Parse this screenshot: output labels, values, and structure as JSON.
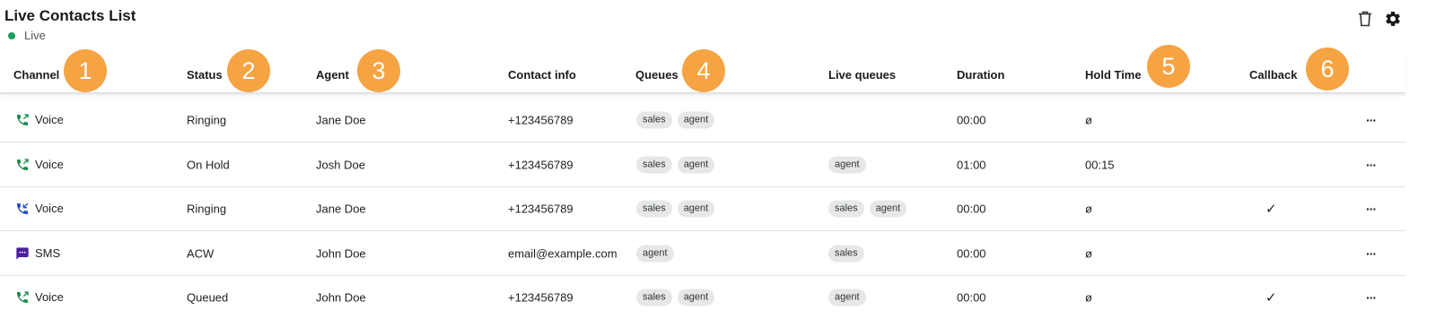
{
  "header": {
    "title": "Live Contacts List",
    "status": "Live"
  },
  "toolbar": {
    "delete_icon": "trash-icon",
    "settings_icon": "gear-icon"
  },
  "columns": [
    {
      "key": "channel",
      "label": "Channel",
      "badge": "1"
    },
    {
      "key": "status",
      "label": "Status",
      "badge": "2"
    },
    {
      "key": "agent",
      "label": "Agent",
      "badge": "3"
    },
    {
      "key": "contact",
      "label": "Contact info",
      "badge": ""
    },
    {
      "key": "queues",
      "label": "Queues",
      "badge": "4"
    },
    {
      "key": "live_queues",
      "label": "Live queues",
      "badge": ""
    },
    {
      "key": "duration",
      "label": "Duration",
      "badge": ""
    },
    {
      "key": "hold",
      "label": "Hold Time",
      "badge": "5"
    },
    {
      "key": "callback",
      "label": "Callback",
      "badge": "6"
    }
  ],
  "rows": [
    {
      "channel": "Voice",
      "channel_icon": "voice-outbound-icon",
      "status": "Ringing",
      "agent": "Jane Doe",
      "contact": "+123456789",
      "queues": [
        "sales",
        "agent"
      ],
      "live_queues": [],
      "duration": "00:00",
      "hold": "ø",
      "callback": ""
    },
    {
      "channel": "Voice",
      "channel_icon": "voice-outbound-icon",
      "status": "On Hold",
      "agent": "Josh Doe",
      "contact": "+123456789",
      "queues": [
        "sales",
        "agent"
      ],
      "live_queues": [
        "agent"
      ],
      "duration": "01:00",
      "hold": "00:15",
      "callback": ""
    },
    {
      "channel": "Voice",
      "channel_icon": "voice-inbound-icon",
      "status": "Ringing",
      "agent": "Jane Doe",
      "contact": "+123456789",
      "queues": [
        "sales",
        "agent"
      ],
      "live_queues": [
        "sales",
        "agent"
      ],
      "duration": "00:00",
      "hold": "ø",
      "callback": "✓"
    },
    {
      "channel": "SMS",
      "channel_icon": "sms-icon",
      "status": "ACW",
      "agent": "John Doe",
      "contact": "email@example.com",
      "queues": [
        "agent"
      ],
      "live_queues": [
        "sales"
      ],
      "duration": "00:00",
      "hold": "ø",
      "callback": ""
    },
    {
      "channel": "Voice",
      "channel_icon": "voice-outbound-icon",
      "status": "Queued",
      "agent": "John Doe",
      "contact": "+123456789",
      "queues": [
        "sales",
        "agent"
      ],
      "live_queues": [
        "agent"
      ],
      "duration": "00:00",
      "hold": "ø",
      "callback": "✓"
    }
  ],
  "row_menu_label": "···",
  "colors": {
    "accent_badge": "#f6a343",
    "live_dot": "#1a9e5a",
    "voice_outbound": "#1a8a4a",
    "voice_inbound": "#1e4bd2",
    "sms": "#4a1e9e"
  }
}
